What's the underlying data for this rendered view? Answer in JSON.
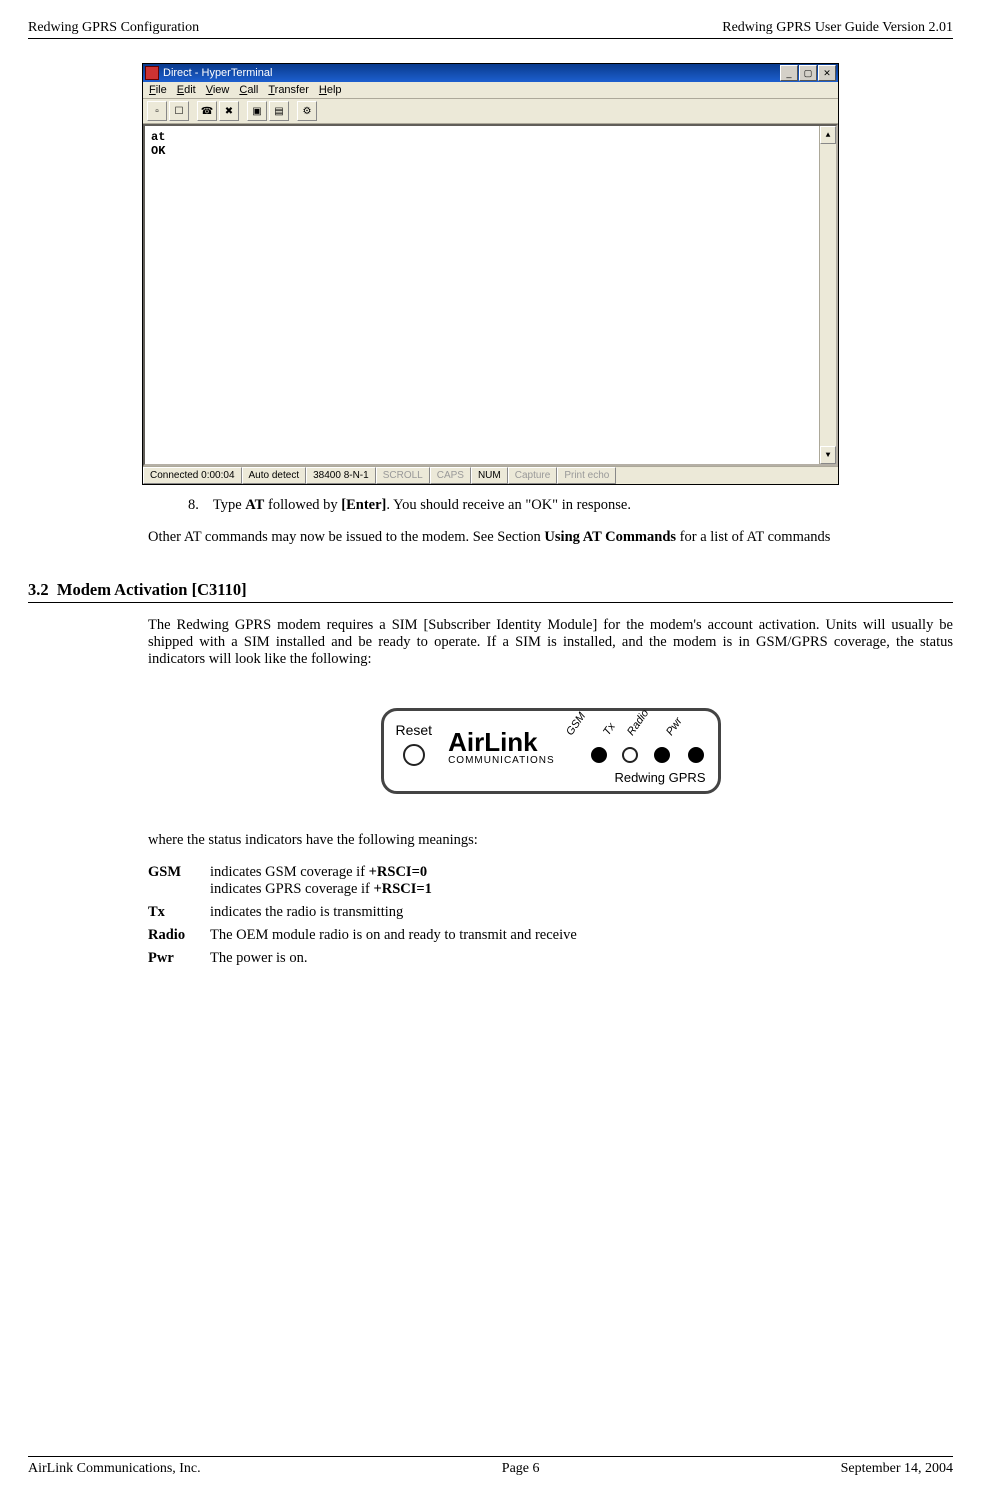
{
  "header": {
    "left": "Redwing GPRS Configuration",
    "right": "Redwing GPRS User Guide Version 2.01"
  },
  "footer": {
    "left": "AirLink Communications, Inc.",
    "center": "Page 6",
    "right": "September 14, 2004"
  },
  "ht": {
    "title": "Direct - HyperTerminal",
    "menu": {
      "file": "File",
      "edit": "Edit",
      "view": "View",
      "call": "Call",
      "transfer": "Transfer",
      "help": "Help"
    },
    "term_line1": "at",
    "term_line2": "OK",
    "status": {
      "conn": "Connected 0:00:04",
      "detect": "Auto detect",
      "baud": "38400 8-N-1",
      "scroll": "SCROLL",
      "caps": "CAPS",
      "num": "NUM",
      "capture": "Capture",
      "echo": "Print echo"
    }
  },
  "step8": {
    "num": "8.",
    "a": "Type ",
    "b": "AT",
    "c": " followed by ",
    "d": "[Enter]",
    "e": ". You should receive an \"OK\" in response."
  },
  "para1": {
    "a": "Other AT commands may now be issued to the modem. See Section ",
    "b": "Using AT Commands",
    "c": " for a list of AT commands"
  },
  "sect": {
    "num": "3.2",
    "title": "Modem Activation [C3110]"
  },
  "para2": "The Redwing GPRS modem requires a SIM [Subscriber Identity Module] for the modem's account activation. Units will usually be shipped with a SIM installed and be ready to operate. If a SIM is installed, and the modem is in GSM/GPRS coverage, the status indicators will look like the following:",
  "panel": {
    "reset": "Reset",
    "brand": "AirLink",
    "brand_sub": "COMMUNICATIONS",
    "model": "Redwing GPRS",
    "leds": {
      "gsm": "GSM",
      "tx": "Tx",
      "radio": "Radio",
      "pwr": "Pwr"
    }
  },
  "para3": "where the status indicators have the following meanings:",
  "defs": {
    "gsm": {
      "term": "GSM",
      "l1a": "indicates GSM coverage if ",
      "l1b": "+RSCI=0",
      "l2a": "indicates GPRS coverage if ",
      "l2b": "+RSCI=1"
    },
    "tx": {
      "term": "Tx",
      "def": "indicates the radio is transmitting"
    },
    "radio": {
      "term": "Radio",
      "def": "The OEM module radio is on and ready to transmit and receive"
    },
    "pwr": {
      "term": "Pwr",
      "def": "The power is on."
    }
  }
}
